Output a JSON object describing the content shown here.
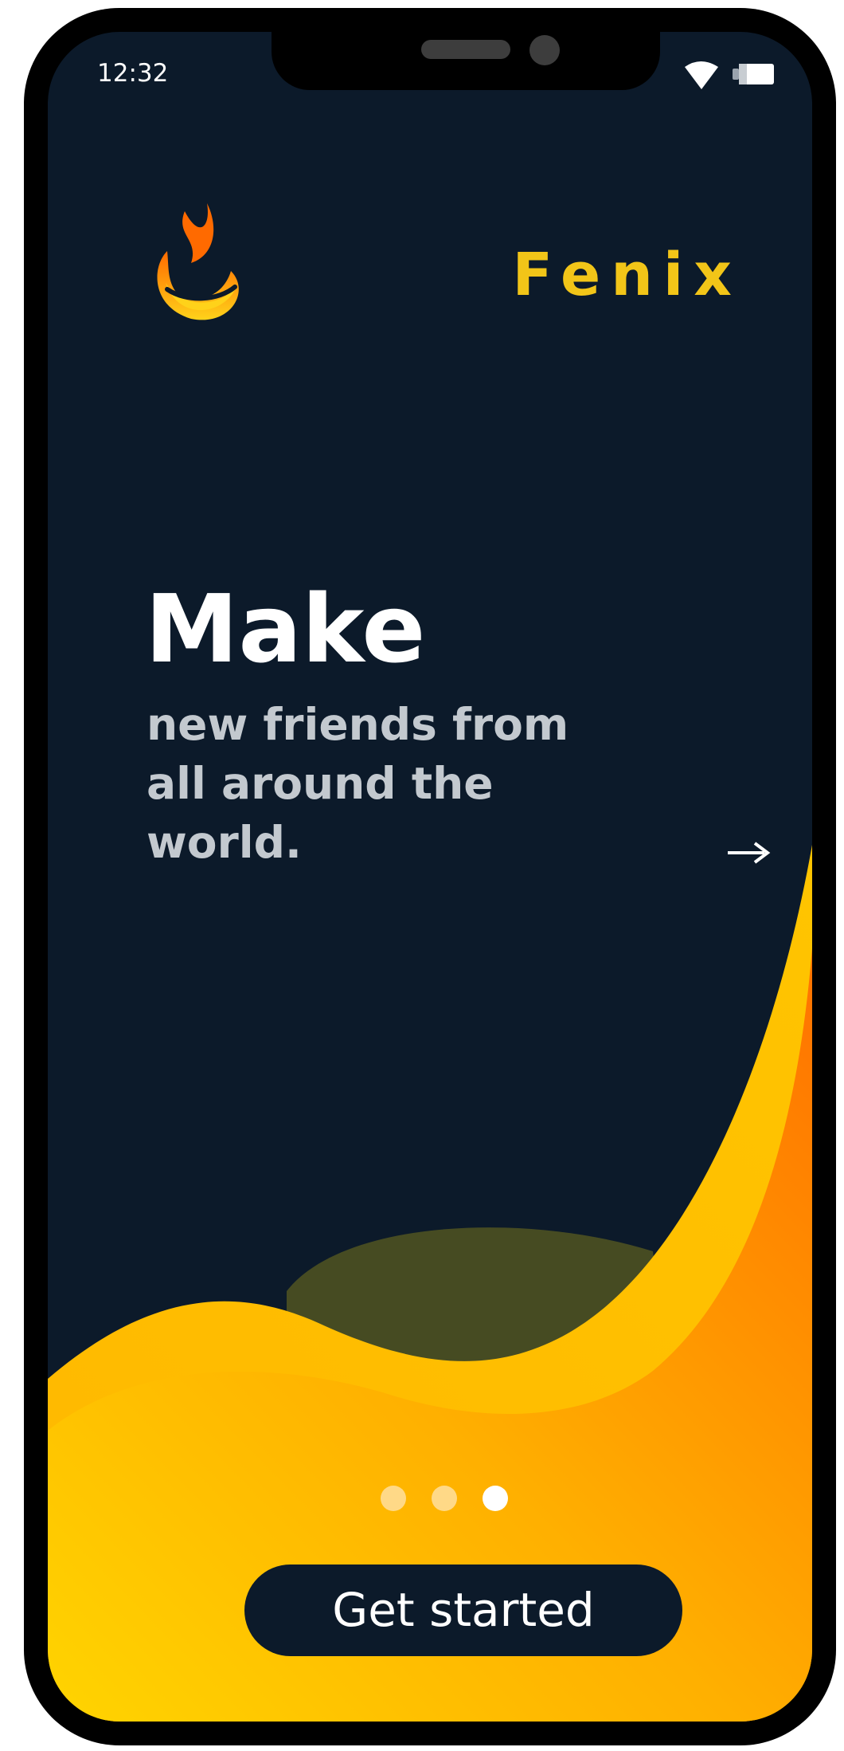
{
  "status_bar": {
    "time": "12:32",
    "icons": [
      "wifi-icon",
      "battery-icon"
    ]
  },
  "brand": {
    "name": "Fenix",
    "logo_icon": "flame-logo-icon",
    "color": "#f2c518"
  },
  "onboarding": {
    "title": "Make",
    "subtitle": "new friends from\nall around the\nworld.",
    "next_icon": "arrow-right-icon"
  },
  "pager": {
    "total": 3,
    "active_index": 2
  },
  "cta": {
    "label": "Get started"
  },
  "colors": {
    "background": "#0c1a2a",
    "accent_yellow": "#ffd20a",
    "accent_orange": "#ff7a00",
    "text_primary": "#ffffff",
    "text_secondary": "#c3c9cf"
  }
}
